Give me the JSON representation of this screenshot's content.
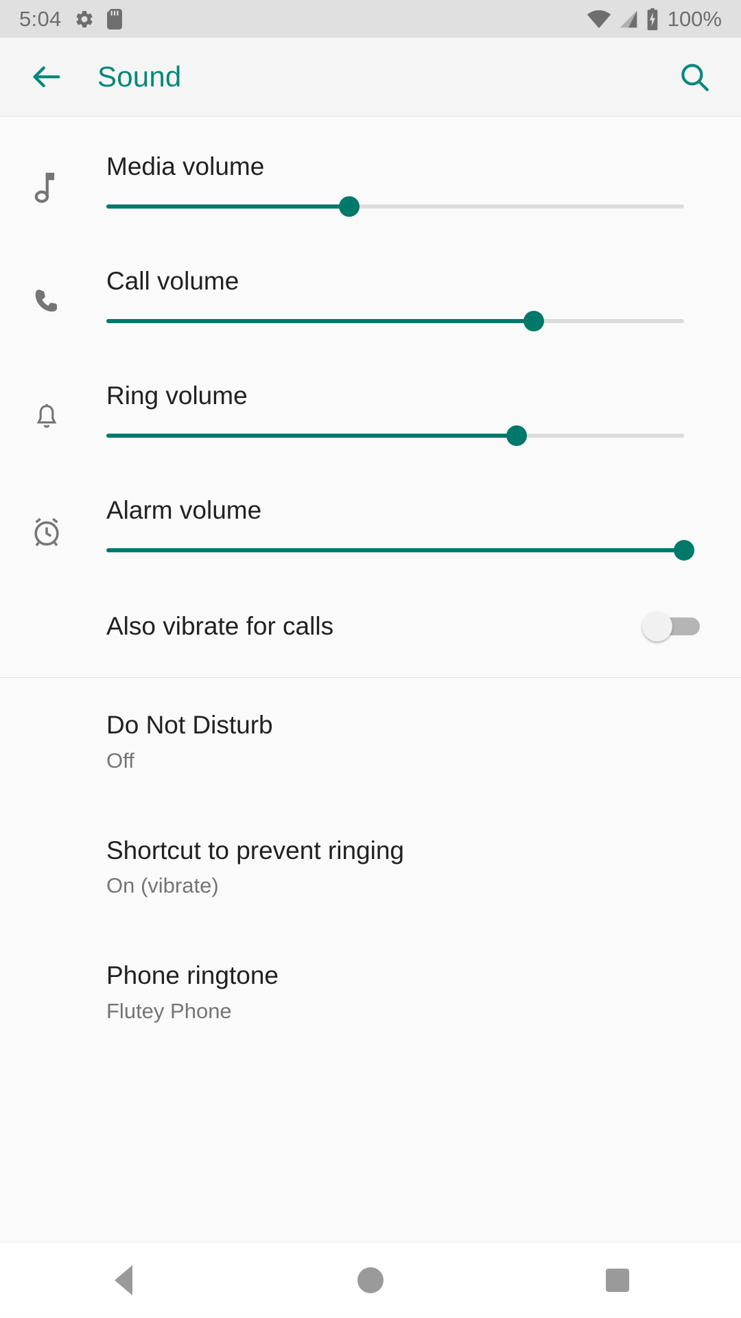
{
  "status_bar": {
    "time": "5:04",
    "battery_text": "100%",
    "icons": [
      "gear-icon",
      "sd-card-icon",
      "wifi-icon",
      "cellular-signal-icon",
      "battery-charging-icon"
    ]
  },
  "app_bar": {
    "back_label": "Back",
    "title": "Sound",
    "search_label": "Search",
    "accent_color": "#00887a"
  },
  "volume_sliders": [
    {
      "icon": "music-note-icon",
      "label": "Media volume",
      "value_percent": 42
    },
    {
      "icon": "phone-icon",
      "label": "Call volume",
      "value_percent": 74
    },
    {
      "icon": "bell-icon",
      "label": "Ring volume",
      "value_percent": 71
    },
    {
      "icon": "alarm-clock-icon",
      "label": "Alarm volume",
      "value_percent": 100
    }
  ],
  "vibrate_switch": {
    "label": "Also vibrate for calls",
    "state": "off"
  },
  "list_items": [
    {
      "title": "Do Not Disturb",
      "subtitle": "Off"
    },
    {
      "title": "Shortcut to prevent ringing",
      "subtitle": "On (vibrate)"
    },
    {
      "title": "Phone ringtone",
      "subtitle": "Flutey Phone"
    }
  ],
  "nav_bar": {
    "back": "Back",
    "home": "Home",
    "recents": "Recent apps"
  },
  "colors": {
    "accent": "#00796b",
    "title": "#00887a",
    "track": "#dcdcdc"
  }
}
